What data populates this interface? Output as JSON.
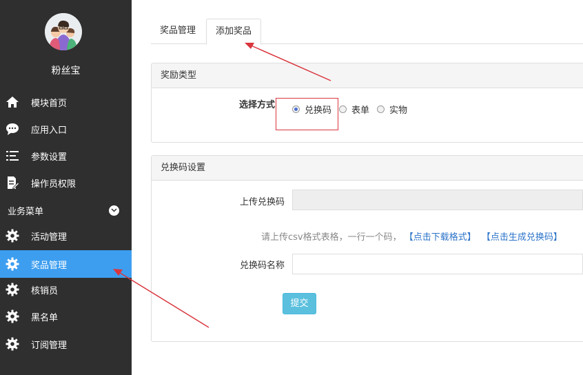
{
  "sidebar": {
    "brand": "粉丝宝",
    "section_header": "业务菜单",
    "top_items": [
      {
        "label": "模块首页",
        "icon": "home-icon"
      },
      {
        "label": "应用入口",
        "icon": "chat-bubble-icon"
      },
      {
        "label": "参数设置",
        "icon": "list-settings-icon"
      },
      {
        "label": "操作员权限",
        "icon": "edit-document-icon"
      }
    ],
    "business_items": [
      {
        "label": "活动管理",
        "icon": "gear-icon"
      },
      {
        "label": "奖品管理",
        "icon": "gear-icon",
        "active": true
      },
      {
        "label": "核销员",
        "icon": "gear-icon"
      },
      {
        "label": "黑名单",
        "icon": "gear-icon"
      },
      {
        "label": "订阅管理",
        "icon": "gear-icon"
      }
    ]
  },
  "tabs": [
    {
      "label": "奖品管理"
    },
    {
      "label": "添加奖品",
      "active": true
    }
  ],
  "reward_type": {
    "title": "奖励类型",
    "select_label": "选择方式",
    "options": [
      "兑换码",
      "表单",
      "实物"
    ],
    "selected": "兑换码"
  },
  "code_settings": {
    "title": "兑换码设置",
    "upload_label": "上传兑换码",
    "hint_text": "请上传csv格式表格，一行一个码，",
    "link_download": "【点击下载格式】",
    "link_generate": "【点击生成兑换码】",
    "name_label": "兑换码名称",
    "name_value": "",
    "submit_label": "提交"
  },
  "colors": {
    "sidebar_bg": "#2f2f2f",
    "active_item": "#3d9ef0",
    "submit_button": "#5bc0de",
    "annotation_red": "#d9363e",
    "link": "#2b73c9"
  }
}
